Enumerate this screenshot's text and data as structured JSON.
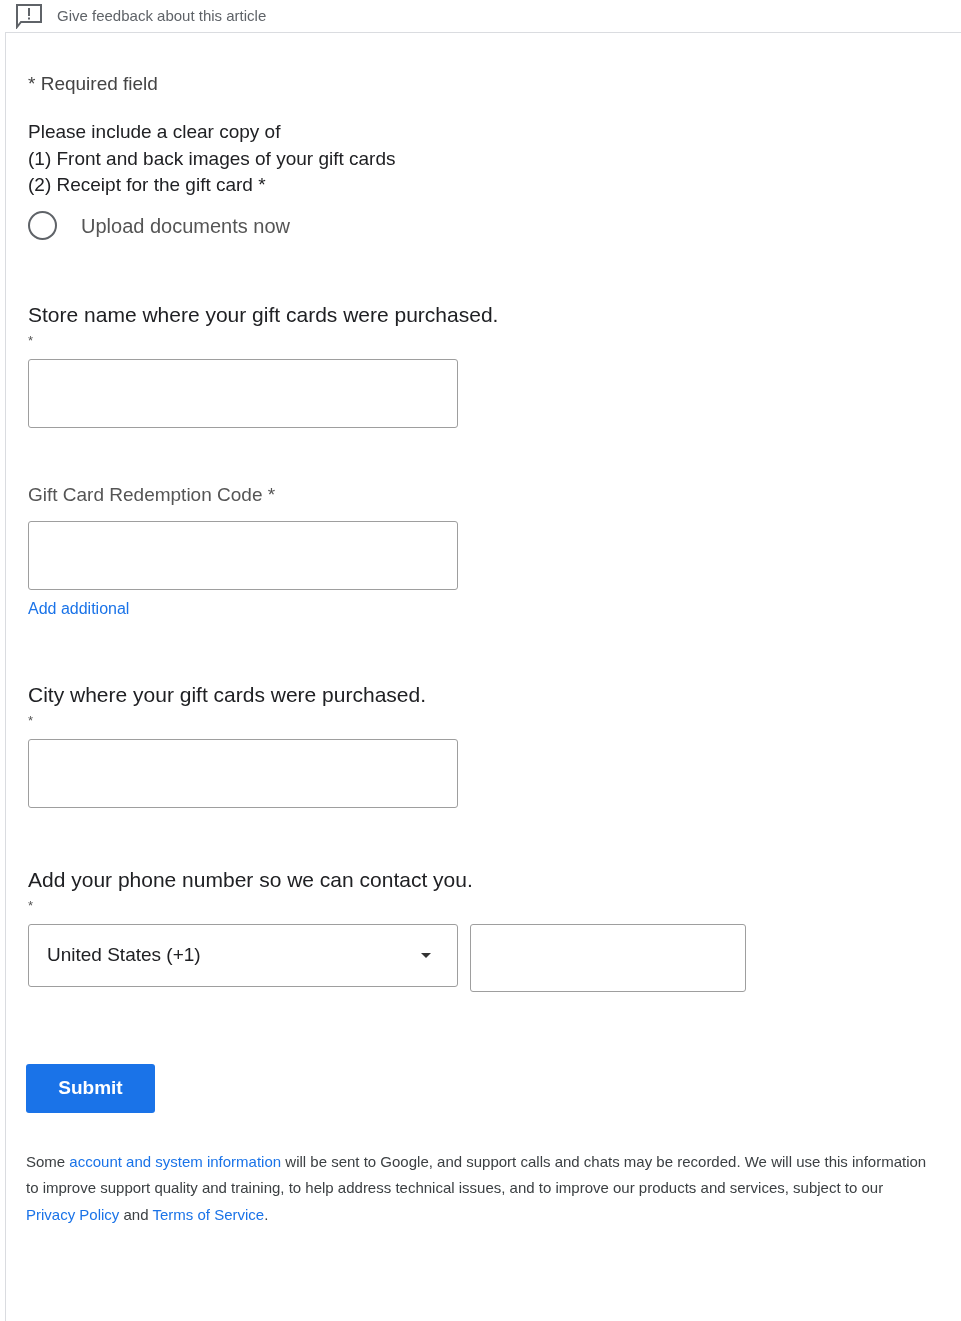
{
  "header": {
    "text": "Give feedback about this article"
  },
  "required_note": "* Required field",
  "instructions": [
    "Please include a clear copy of",
    "(1) Front and back images of your gift cards",
    "(2) Receipt for the gift card *"
  ],
  "upload_option": {
    "label": "Upload documents now",
    "selected": false
  },
  "sections": [
    {
      "kind": "question",
      "label": "Store name where your gift cards were purchased.",
      "mark": "*"
    },
    {
      "kind": "labeled",
      "label": "Gift Card Redemption Code *",
      "link": "Add additional"
    },
    {
      "kind": "question",
      "label": "City where your gift cards were purchased.",
      "mark": "*"
    },
    {
      "kind": "phone",
      "label": "Add your phone number so we can contact you.",
      "mark": "*",
      "country": "United States (+1)"
    }
  ],
  "submit": "Submit",
  "footer": [
    {
      "kind": "text",
      "text": "Some "
    },
    {
      "kind": "link",
      "text": "account and system information"
    },
    {
      "kind": "text",
      "text": " will be sent to Google, and support calls and chats may be recorded. We will use this information to improve support quality and training, to help address technical issues, and to improve our products and services, subject to our "
    },
    {
      "kind": "link",
      "text": "Privacy Policy"
    },
    {
      "kind": "text",
      "text": " and "
    },
    {
      "kind": "link",
      "text": "Terms of Service"
    },
    {
      "kind": "text",
      "text": "."
    }
  ]
}
